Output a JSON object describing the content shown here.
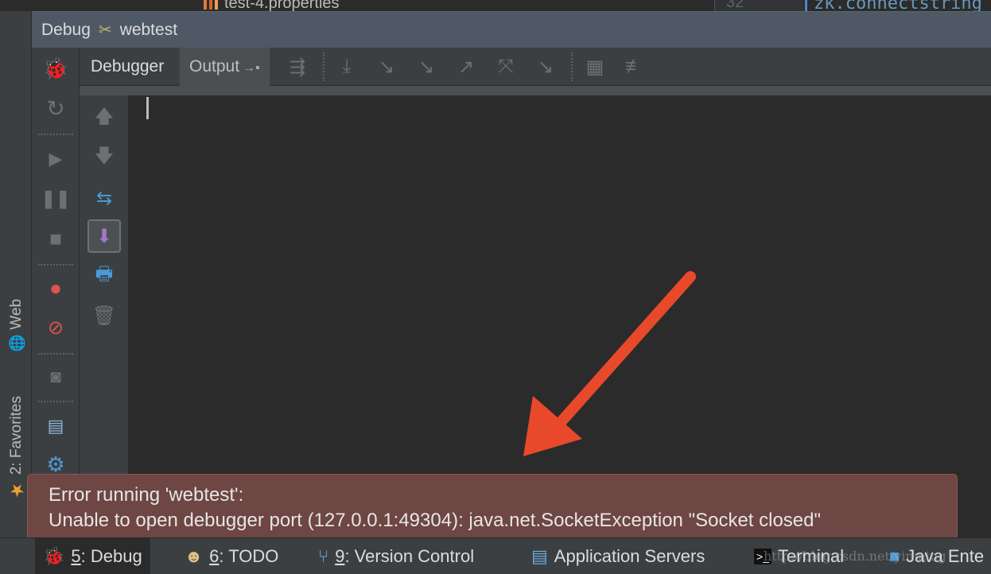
{
  "editor_strip": {
    "file_name": "test-4.properties",
    "line_number": "32",
    "code_fragment": "zk.connectstring"
  },
  "side_tabs": {
    "web": "Web",
    "favorites": "2: Favorites"
  },
  "debug_window": {
    "label": "Debug",
    "config_name": "webtest",
    "tabs": [
      {
        "label": "Debugger",
        "active": false
      },
      {
        "label": "Output",
        "active": true
      }
    ]
  },
  "error_balloon": {
    "line1": "Error running 'webtest':",
    "line2": "Unable to open debugger port (127.0.0.1:49304): java.net.SocketException \"Socket closed\""
  },
  "bottom_bar": {
    "items": [
      {
        "num": "5",
        "label": ": Debug",
        "icon": "bug-icon",
        "active": true
      },
      {
        "num": "6",
        "label": ": TODO",
        "icon": "todo-icon",
        "active": false
      },
      {
        "num": "9",
        "label": ": Version Control",
        "icon": "vcs-icon",
        "active": false
      },
      {
        "num": "",
        "label": "Application Servers",
        "icon": "server-icon",
        "active": false
      },
      {
        "num": "",
        "label": "Terminal",
        "icon": "terminal-icon",
        "active": false
      },
      {
        "num": "",
        "label": "Java Ente",
        "icon": "java-ee-icon",
        "active": false
      }
    ]
  },
  "watermark": "http://blog.csdn.net/yinming",
  "colors": {
    "error_background": "#6e4643",
    "arrow": "#e8492b",
    "header_background": "#4e5965",
    "console_background": "#2b2b2b"
  }
}
